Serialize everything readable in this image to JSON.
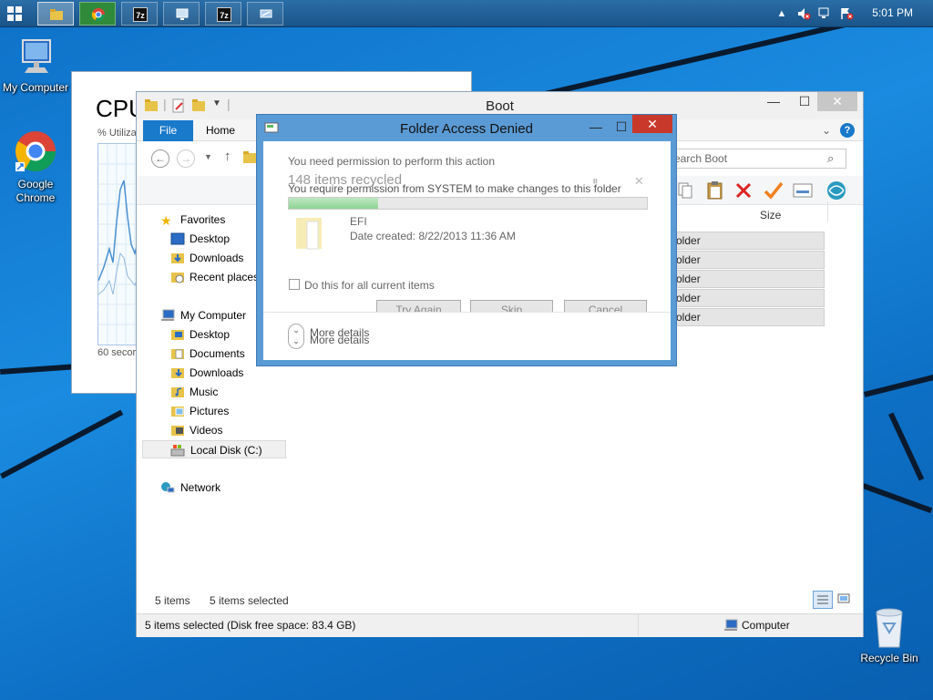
{
  "taskbar": {
    "apps": [
      {
        "name": "file-explorer",
        "active": true
      },
      {
        "name": "chrome"
      },
      {
        "name": "7zip-1",
        "label": "7z"
      },
      {
        "name": "computer"
      },
      {
        "name": "7zip-2",
        "label": "7z"
      },
      {
        "name": "app-6"
      }
    ],
    "clock": "5:01 PM"
  },
  "desktop": {
    "icons": {
      "my_computer": "My Computer",
      "chrome": "Google Chrome",
      "recycle_bin": "Recycle Bin"
    }
  },
  "task_manager": {
    "title": "CPU",
    "subtitle": "% Utiliza",
    "footer": "60 secor"
  },
  "explorer": {
    "title": "Boot",
    "tabs": {
      "file": "File",
      "home": "Home"
    },
    "search_placeholder": "earch Boot",
    "column_size": "Size",
    "rows": [
      "older",
      "older",
      "older",
      "older",
      "older"
    ],
    "nav": {
      "favorites": "Favorites",
      "fav_items": [
        "Desktop",
        "Downloads",
        "Recent places"
      ],
      "my_computer": "My Computer",
      "pc_items": [
        "Desktop",
        "Documents",
        "Downloads",
        "Music",
        "Pictures",
        "Videos",
        "Local Disk (C:)"
      ],
      "network": "Network"
    },
    "status_items": "5 items",
    "status_selected": "5 items selected",
    "statusbar_left": "5 items selected (Disk free space: 83.4 GB)",
    "statusbar_right": "Computer"
  },
  "dialog": {
    "title": "Folder Access Denied",
    "ghost_line1": "You need permission to perform this action",
    "ghost_line2": "148 items recycled",
    "message": "You require permission from SYSTEM to make changes to this folder",
    "progress": 0.25,
    "folder_name": "EFI",
    "folder_date": "Date created: 8/22/2013 11:36 AM",
    "checkbox_label": "Do this for all current items",
    "buttons": {
      "try_again": "Try Again",
      "skip": "Skip",
      "cancel": "Cancel"
    },
    "more_details": "More details"
  }
}
